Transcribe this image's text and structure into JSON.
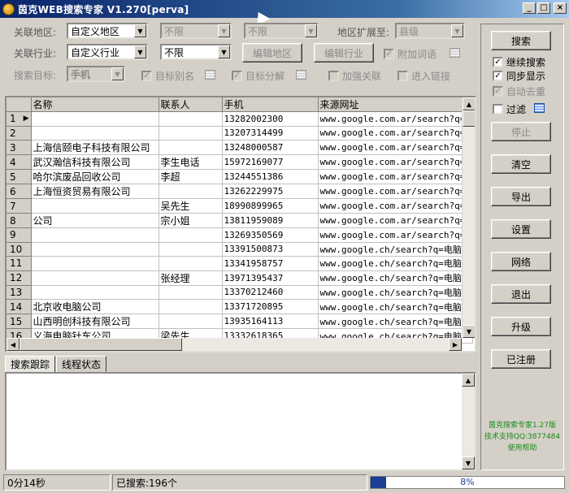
{
  "window": {
    "title": "茵克WEB搜索专家 V1.270[perva]",
    "buttons": [
      "_",
      "□",
      "×"
    ]
  },
  "filters": {
    "region_label": "关联地区:",
    "region_value": "自定义地区",
    "region2_value": "不限",
    "region3_value": "不限",
    "expand_label": "地区扩展至:",
    "expand_value": "县级",
    "industry_label": "关联行业:",
    "industry_value": "自定义行业",
    "industry2_value": "不限",
    "edit_region_label": "编辑地区",
    "edit_industry_label": "编辑行业",
    "extra_words_label": "附加词语",
    "target_label": "搜索目标:",
    "target_value": "手机",
    "alias_label": "目标别名",
    "split_label": "目标分解",
    "strengthen_label": "加强关联",
    "enter_link_label": "进入链接"
  },
  "grid": {
    "columns": [
      "名称",
      "联系人",
      "手机",
      "来源网址"
    ],
    "rows": [
      {
        "n": "1",
        "name": "",
        "contact": "",
        "phone": "13282002300",
        "url": "www.google.com.ar/search?q="
      },
      {
        "n": "2",
        "name": "",
        "contact": "",
        "phone": "13207314499",
        "url": "www.google.com.ar/search?q="
      },
      {
        "n": "3",
        "name": "上海信颐电子科技有限公司",
        "contact": "",
        "phone": "13248000587",
        "url": "www.google.com.ar/search?q="
      },
      {
        "n": "4",
        "name": "武汉瀚信科技有限公司",
        "contact": "李生电话",
        "phone": "15972169077",
        "url": "www.google.com.ar/search?q="
      },
      {
        "n": "5",
        "name": "哈尔滨废品回收公司",
        "contact": "李超",
        "phone": "13244551386",
        "url": "www.google.com.ar/search?q="
      },
      {
        "n": "6",
        "name": "上海恒资贸易有限公司",
        "contact": "",
        "phone": "13262229975",
        "url": "www.google.com.ar/search?q="
      },
      {
        "n": "7",
        "name": "",
        "contact": "吴先生",
        "phone": "18990899965",
        "url": "www.google.com.ar/search?q="
      },
      {
        "n": "8",
        "name": "公司",
        "contact": "宗小姐",
        "phone": "13811959089",
        "url": "www.google.com.ar/search?q="
      },
      {
        "n": "9",
        "name": "",
        "contact": "",
        "phone": "13269350569",
        "url": "www.google.com.ar/search?q="
      },
      {
        "n": "10",
        "name": "",
        "contact": "",
        "phone": "13391500873",
        "url": "www.google.ch/search?q=电脑"
      },
      {
        "n": "11",
        "name": "",
        "contact": "",
        "phone": "13341958757",
        "url": "www.google.ch/search?q=电脑"
      },
      {
        "n": "12",
        "name": "",
        "contact": "张经理",
        "phone": "13971395437",
        "url": "www.google.ch/search?q=电脑"
      },
      {
        "n": "13",
        "name": "",
        "contact": "",
        "phone": "13370212460",
        "url": "www.google.ch/search?q=电脑"
      },
      {
        "n": "14",
        "name": "北京收电脑公司",
        "contact": "",
        "phone": "13371720895",
        "url": "www.google.ch/search?q=电脑"
      },
      {
        "n": "15",
        "name": "山西明创科技有限公司",
        "contact": "",
        "phone": "13935164113",
        "url": "www.google.ch/search?q=电脑"
      },
      {
        "n": "16",
        "name": "义海电脑针车公司",
        "contact": "梁先生",
        "phone": "13332618365",
        "url": "www.google.ch/search?q=电脑"
      }
    ]
  },
  "tabs": [
    "搜索跟踪",
    "线程状态"
  ],
  "side": {
    "search": "搜索",
    "continue_search": "继续搜索",
    "sync_display": "同步显示",
    "auto_dedup": "自动去重",
    "filter": "过滤",
    "stop": "停止",
    "clear": "清空",
    "export": "导出",
    "settings": "设置",
    "network": "网络",
    "exit": "退出",
    "upgrade": "升级",
    "registered": "已注册",
    "footer_line1": "茵克搜索专家1.27版",
    "footer_line2": "技术支持QQ:3877484",
    "footer_line3": "使用帮助"
  },
  "status": {
    "elapsed": "0分14秒",
    "searched": "已搜索:196个",
    "progress_text": "8%",
    "progress_value": 8
  },
  "colors": {
    "titlebar": "#0a246a",
    "progress": "#1c3f94",
    "footer_text": "#1a8a1a"
  }
}
